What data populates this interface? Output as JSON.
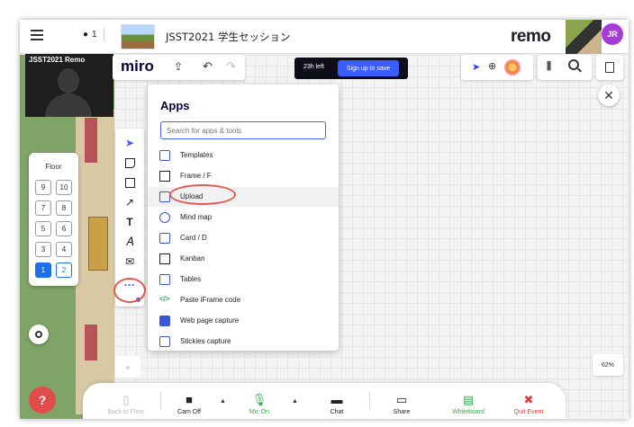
{
  "topbar": {
    "attendee_count": "1",
    "event_title": "JSST2021 学生セッション",
    "brand": "remo",
    "user_initials": "JR"
  },
  "video_tile": {
    "name": "JSST2021 Remo"
  },
  "floor_panel": {
    "label": "Floor",
    "floors": [
      [
        "9",
        "10"
      ],
      [
        "7",
        "8"
      ],
      [
        "5",
        "6"
      ],
      [
        "3",
        "4"
      ],
      [
        "1",
        "2"
      ]
    ],
    "active_floor": "1"
  },
  "miro": {
    "logo": "miro",
    "timer": "23h left",
    "signup_label": "Sign up to save",
    "zoom_level": "62%",
    "expand_label": "»"
  },
  "apps_panel": {
    "title": "Apps",
    "search_placeholder": "Search for apps & tools",
    "items": [
      {
        "label": "Templates",
        "icon": "templates-icon"
      },
      {
        "label": "Frame / F",
        "icon": "frame-icon"
      },
      {
        "label": "Upload",
        "icon": "upload-icon"
      },
      {
        "label": "Mind map",
        "icon": "mind-map-icon"
      },
      {
        "label": "Card / D",
        "icon": "card-icon"
      },
      {
        "label": "Kanban",
        "icon": "kanban-icon"
      },
      {
        "label": "Tables",
        "icon": "tables-icon"
      },
      {
        "label": "Paste iFrame code",
        "icon": "code-icon"
      },
      {
        "label": "Web page capture",
        "icon": "web-capture-icon"
      },
      {
        "label": "Stickies capture",
        "icon": "stickies-capture-icon"
      }
    ],
    "highlighted_item": "Upload"
  },
  "bottom_bar": {
    "back_to_floor": "Back to Floor",
    "cam": "Cam Off",
    "mic": "Mic On",
    "chat": "Chat",
    "share": "Share",
    "whiteboard": "Whiteboard",
    "quit": "Quit Event"
  },
  "colors": {
    "accent": "#3b5cff",
    "annotation": "#e2574c",
    "mic_on": "#35a853",
    "quit": "#e03b3b",
    "avatar": "#a83ad6"
  }
}
